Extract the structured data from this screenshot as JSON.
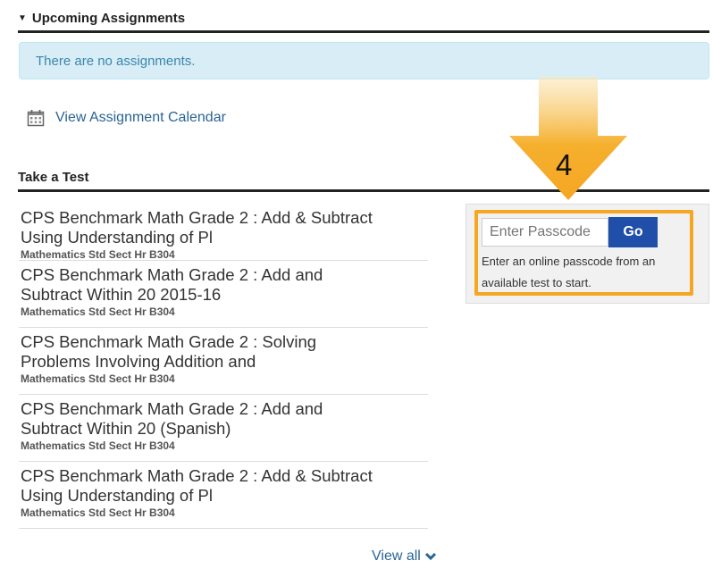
{
  "upcoming": {
    "title": "Upcoming Assignments",
    "empty_message": "There are no assignments.",
    "calendar_link": "View Assignment Calendar"
  },
  "take_test": {
    "title": "Take a Test",
    "tests": [
      {
        "title_line1": "CPS Benchmark Math Grade 2 : Add & Subtract",
        "title_line2": "Using Understanding of Pl",
        "section": "Mathematics Std Sect Hr B304"
      },
      {
        "title_line1": "CPS Benchmark Math Grade 2 : Add and",
        "title_line2": "Subtract Within 20 2015-16",
        "section": "Mathematics Std Sect Hr B304"
      },
      {
        "title_line1": "CPS Benchmark Math Grade 2 : Solving",
        "title_line2": "Problems Involving Addition and",
        "section": "Mathematics Std Sect Hr B304"
      },
      {
        "title_line1": "CPS Benchmark Math Grade 2 : Add and",
        "title_line2": "Subtract Within 20 (Spanish)",
        "section": "Mathematics Std Sect Hr B304"
      },
      {
        "title_line1": "CPS Benchmark Math Grade 2 : Add & Subtract",
        "title_line2": "Using Understanding of Pl",
        "section": "Mathematics Std Sect Hr B304"
      }
    ],
    "view_all": "View all"
  },
  "passcode": {
    "placeholder": "Enter Passcode",
    "go_label": "Go",
    "help_text": "Enter an online passcode from an available test to start."
  },
  "annotation": {
    "step_number": "4",
    "arrow_color": "#f5a623"
  }
}
